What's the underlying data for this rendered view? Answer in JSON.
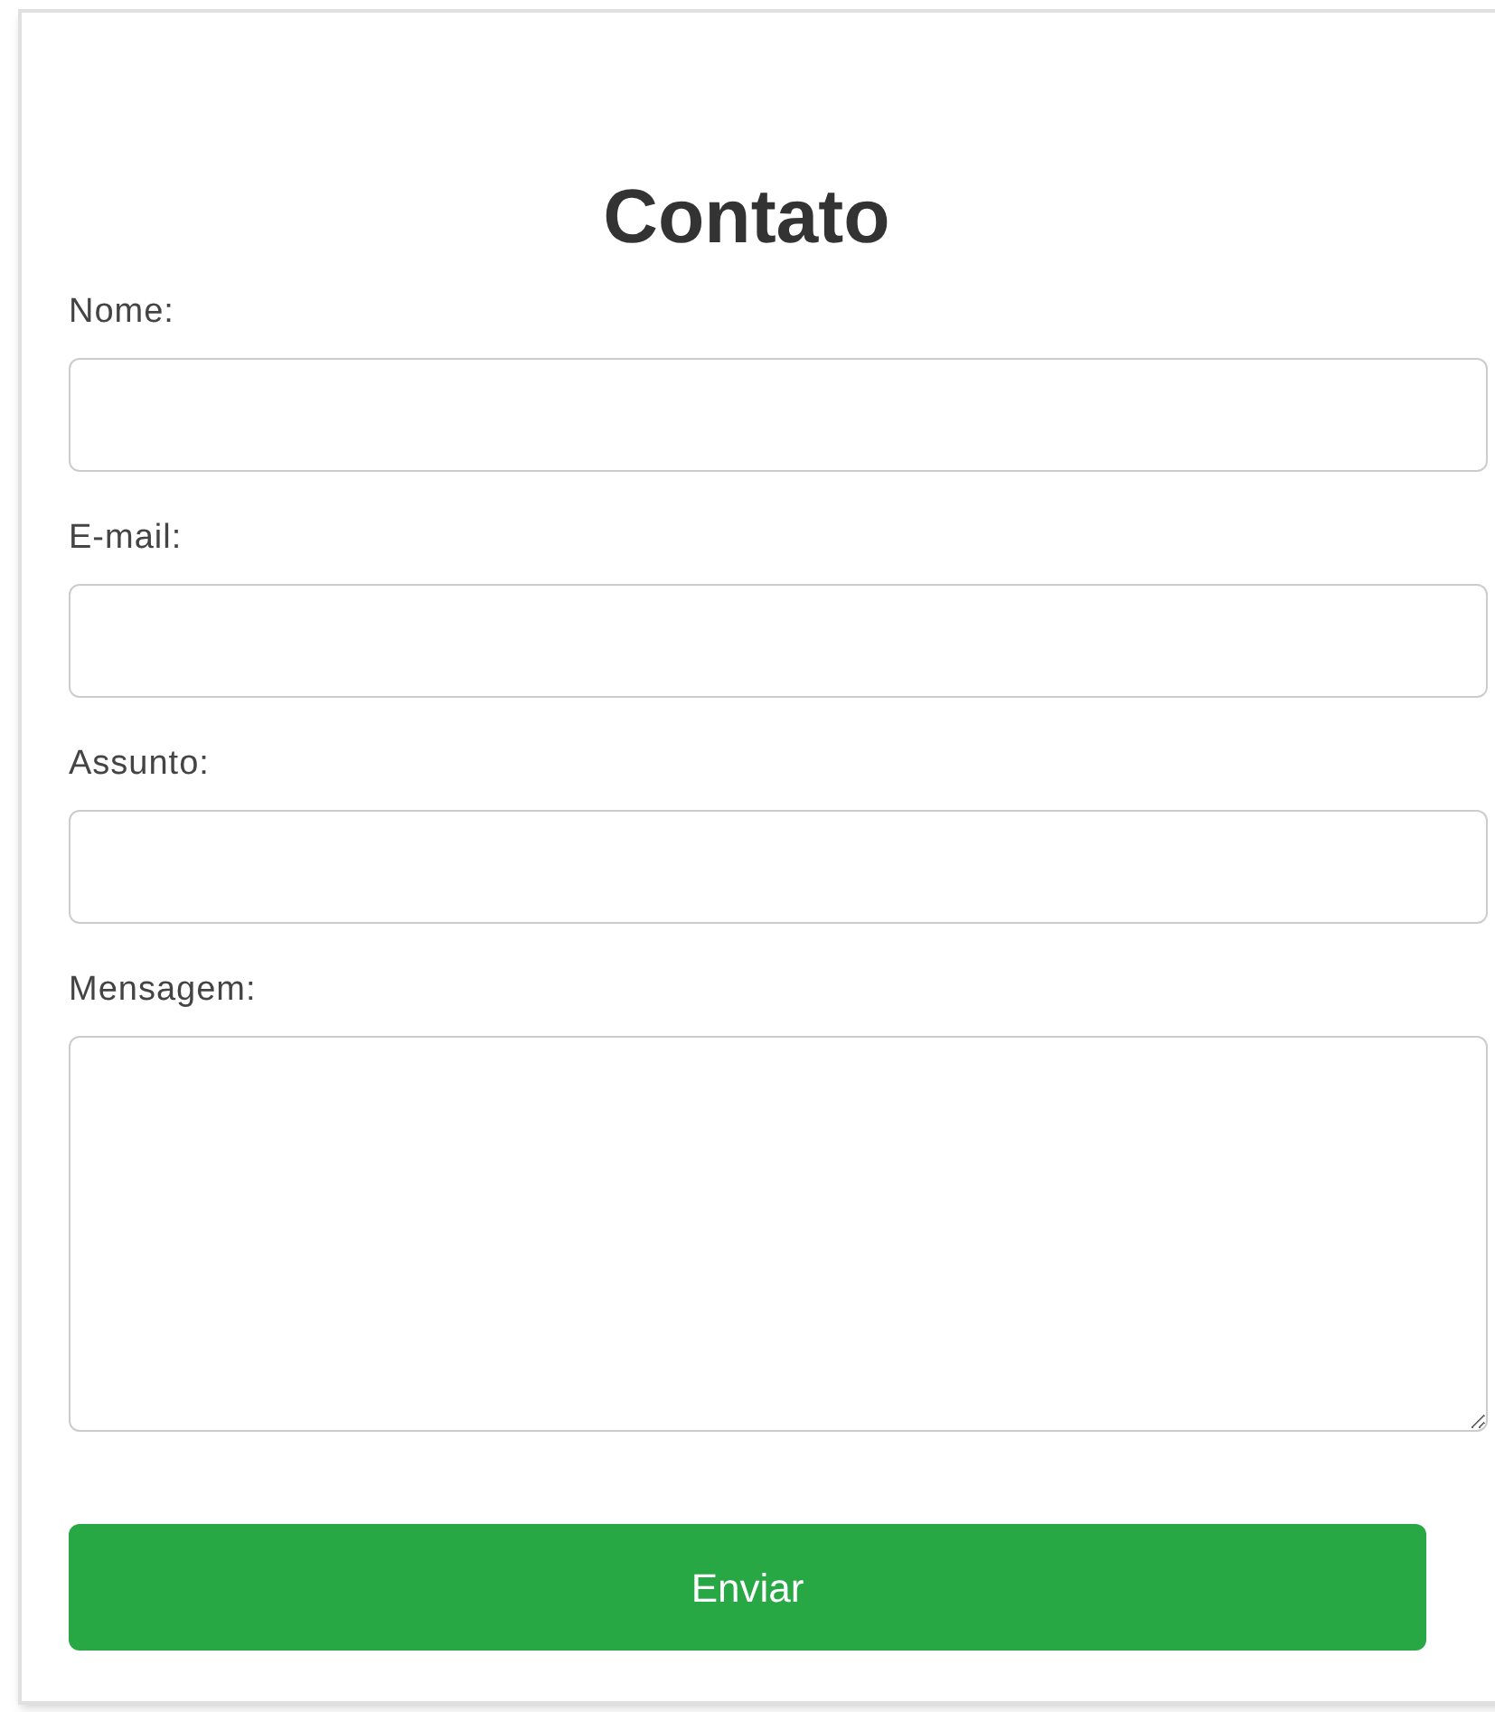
{
  "title": "Contato",
  "fields": [
    {
      "kind": "input",
      "label": "Nome:"
    },
    {
      "kind": "input",
      "label": "E-mail:"
    },
    {
      "kind": "input",
      "label": "Assunto:"
    },
    {
      "kind": "textarea",
      "label": "Mensagem:"
    }
  ],
  "submit": {
    "label": "Enviar"
  }
}
